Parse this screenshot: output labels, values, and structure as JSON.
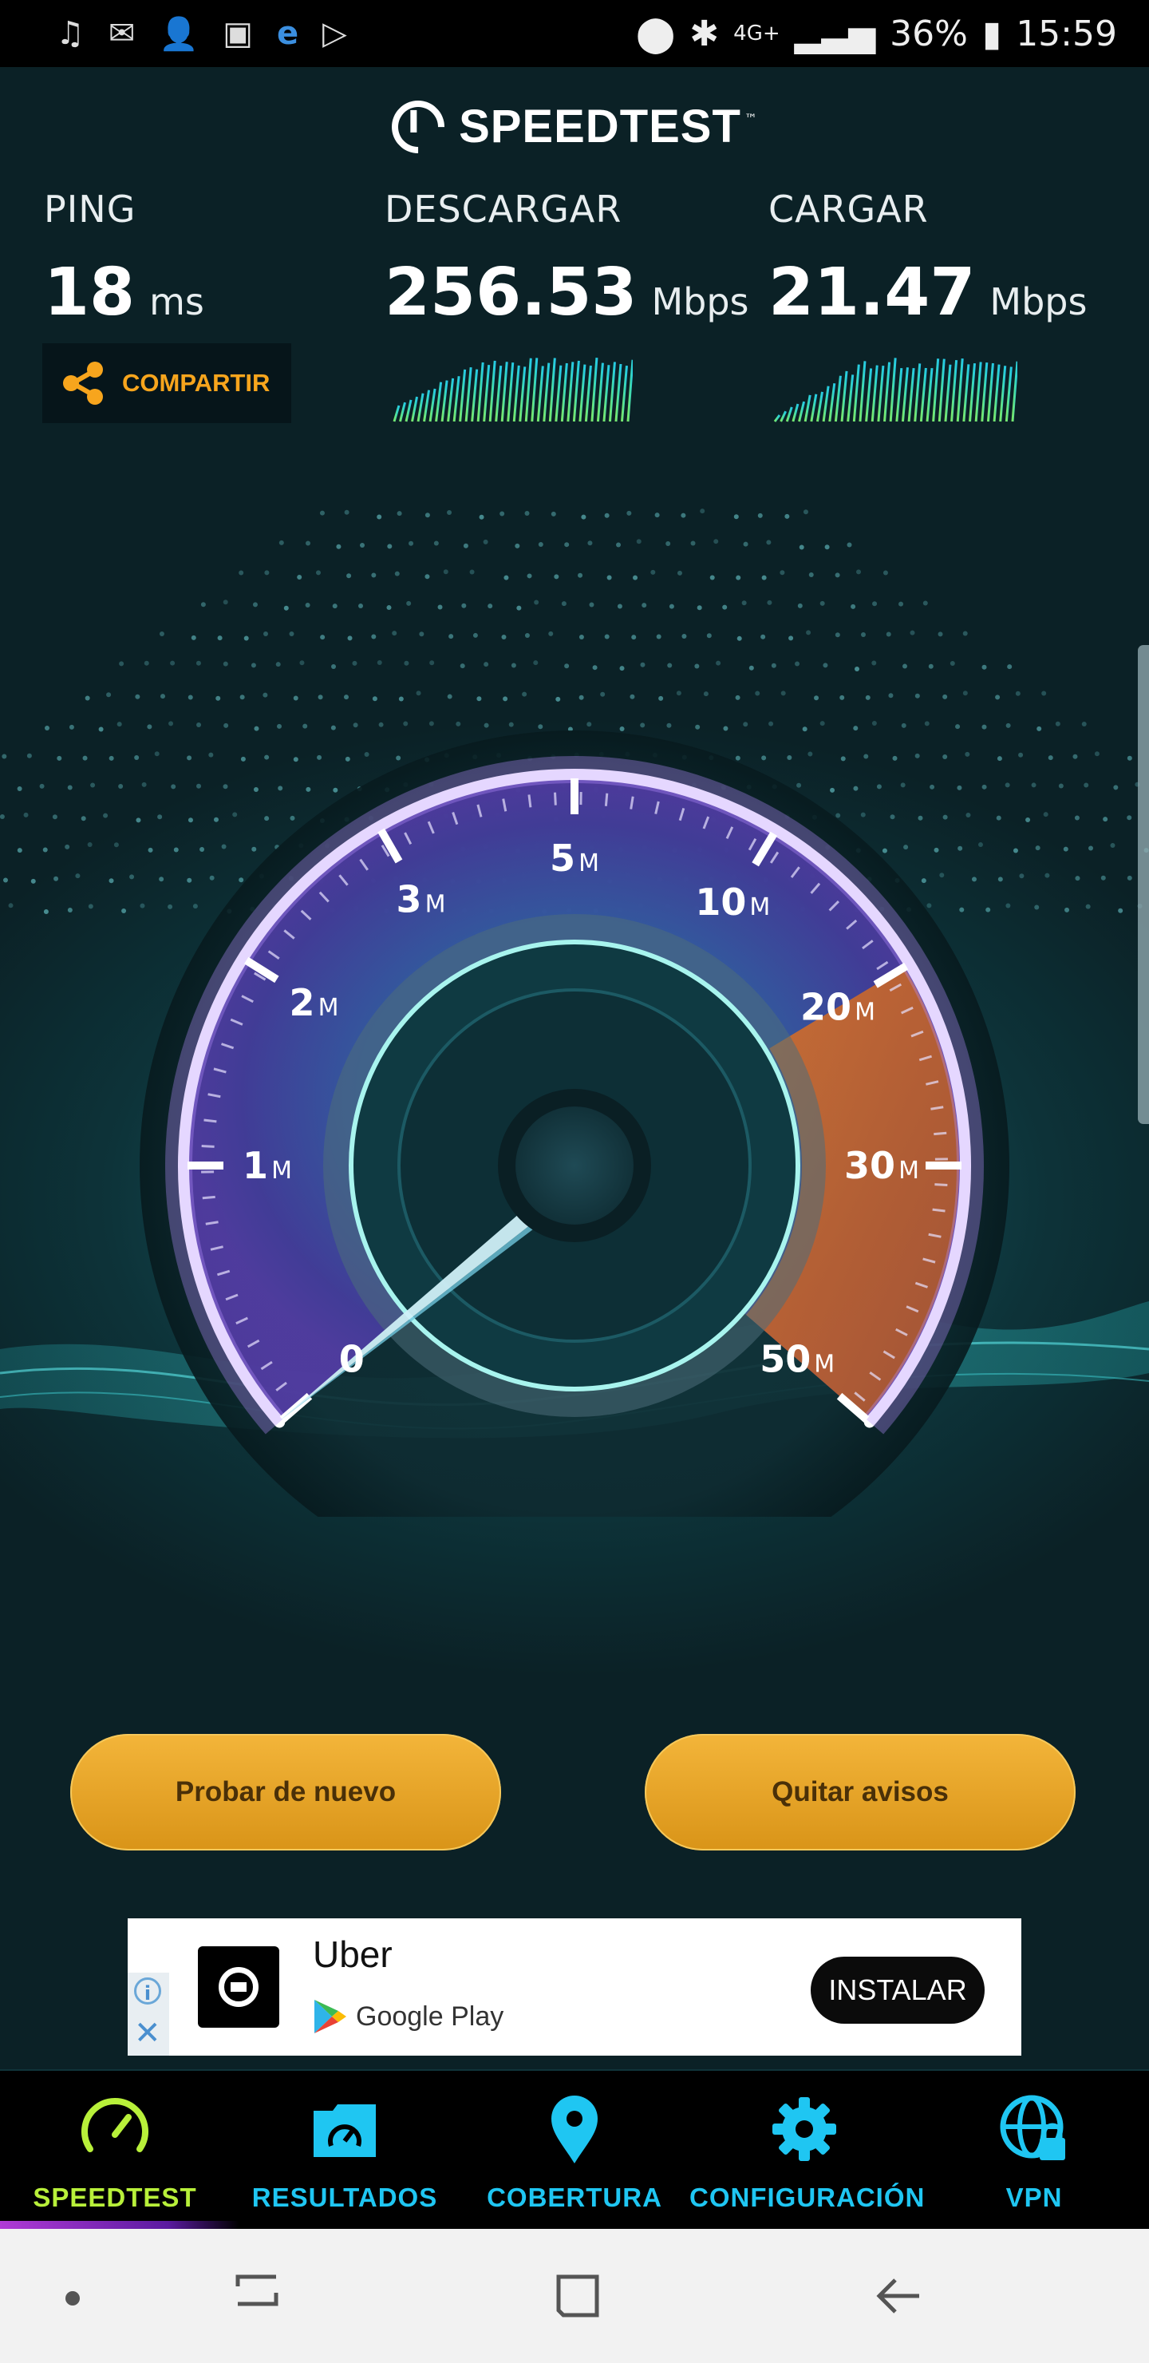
{
  "status_bar": {
    "left_icons": [
      "music-icon",
      "gmail-icon",
      "add-contact-icon",
      "gallery-icon",
      "browser-e-icon",
      "play-store-icon"
    ],
    "network": "4G+",
    "battery": "36%",
    "time": "15:59"
  },
  "app": {
    "brand": "SPEEDTEST",
    "trademark": "™"
  },
  "metrics": {
    "ping": {
      "label": "PING",
      "value": "18",
      "unit": "ms"
    },
    "download": {
      "label": "DESCARGAR",
      "value": "256.53",
      "unit": "Mbps"
    },
    "upload": {
      "label": "CARGAR",
      "value": "21.47",
      "unit": "Mbps"
    }
  },
  "share_label": "COMPARTIR",
  "gauge": {
    "ticks": [
      {
        "num": "0",
        "unit": ""
      },
      {
        "num": "1",
        "unit": "M"
      },
      {
        "num": "2",
        "unit": "M"
      },
      {
        "num": "3",
        "unit": "M"
      },
      {
        "num": "5",
        "unit": "M"
      },
      {
        "num": "10",
        "unit": "M"
      },
      {
        "num": "20",
        "unit": "M"
      },
      {
        "num": "30",
        "unit": "M"
      },
      {
        "num": "50",
        "unit": "M"
      }
    ]
  },
  "buttons": {
    "retry": "Probar de nuevo",
    "remove_ads": "Quitar avisos"
  },
  "ad": {
    "app_name": "Uber",
    "store": "Google Play",
    "install": "INSTALAR"
  },
  "nav": [
    {
      "label": "SPEEDTEST",
      "icon": "speedometer-icon",
      "active": true
    },
    {
      "label": "RESULTADOS",
      "icon": "results-folder-icon",
      "active": false
    },
    {
      "label": "COBERTURA",
      "icon": "location-pin-icon",
      "active": false
    },
    {
      "label": "CONFIGURACIÓN",
      "icon": "gear-icon",
      "active": false
    },
    {
      "label": "VPN",
      "icon": "vpn-globe-icon",
      "active": false
    }
  ],
  "colors": {
    "accent_orange": "#f7a51d",
    "nav_blue": "#1fc6f2",
    "nav_active": "#b8f03a",
    "button_gold": "#e6a828"
  }
}
